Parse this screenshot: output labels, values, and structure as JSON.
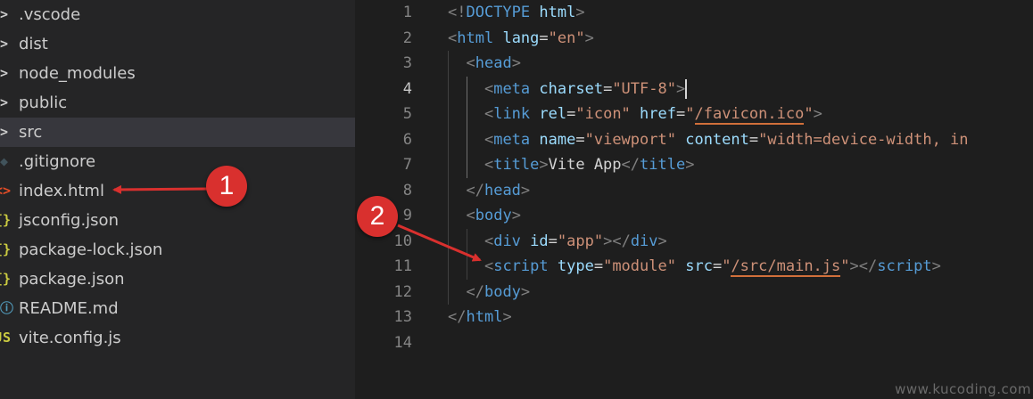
{
  "explorer": {
    "items": [
      {
        "label": ".vscode",
        "icon": "chevron-right-icon",
        "glyph": ">",
        "color": "#cccccc"
      },
      {
        "label": "dist",
        "icon": "chevron-right-icon",
        "glyph": ">",
        "color": "#cccccc"
      },
      {
        "label": "node_modules",
        "icon": "chevron-right-icon",
        "glyph": ">",
        "color": "#cccccc"
      },
      {
        "label": "public",
        "icon": "chevron-right-icon",
        "glyph": ">",
        "color": "#cccccc"
      },
      {
        "label": "src",
        "icon": "chevron-right-icon",
        "glyph": ">",
        "color": "#cccccc",
        "selected": true
      },
      {
        "label": ".gitignore",
        "icon": "git-file-icon",
        "glyph": "◆",
        "color": "#41535b"
      },
      {
        "label": "index.html",
        "icon": "html-file-icon",
        "glyph": "<>",
        "color": "#e44d26"
      },
      {
        "label": "jsconfig.json",
        "icon": "json-file-icon",
        "glyph": "{}",
        "color": "#cbcb41"
      },
      {
        "label": "package-lock.json",
        "icon": "json-file-icon",
        "glyph": "{}",
        "color": "#cbcb41"
      },
      {
        "label": "package.json",
        "icon": "json-file-icon",
        "glyph": "{}",
        "color": "#cbcb41"
      },
      {
        "label": "README.md",
        "icon": "info-file-icon",
        "glyph": "ⓘ",
        "color": "#519aba"
      },
      {
        "label": "vite.config.js",
        "icon": "js-file-icon",
        "glyph": "JS",
        "color": "#cbcb41"
      }
    ]
  },
  "editor": {
    "current_line": 4,
    "lines": [
      {
        "n": "1",
        "tokens": [
          [
            "br",
            "<!"
          ],
          [
            "tag",
            "DOCTYPE"
          ],
          [
            "txt",
            " "
          ],
          [
            "attr",
            "html"
          ],
          [
            "br",
            ">"
          ]
        ]
      },
      {
        "n": "2",
        "tokens": [
          [
            "br",
            "<"
          ],
          [
            "tag",
            "html"
          ],
          [
            "txt",
            " "
          ],
          [
            "attr",
            "lang"
          ],
          [
            "txt",
            "="
          ],
          [
            "str",
            "\"en\""
          ],
          [
            "br",
            ">"
          ]
        ]
      },
      {
        "n": "3",
        "tokens": [
          [
            "txt",
            "  "
          ],
          [
            "br",
            "<"
          ],
          [
            "tag",
            "head"
          ],
          [
            "br",
            ">"
          ]
        ]
      },
      {
        "n": "4",
        "tokens": [
          [
            "txt",
            "    "
          ],
          [
            "br",
            "<"
          ],
          [
            "tag",
            "meta"
          ],
          [
            "txt",
            " "
          ],
          [
            "attr",
            "charset"
          ],
          [
            "txt",
            "="
          ],
          [
            "str",
            "\"UTF-8\""
          ],
          [
            "br",
            ">"
          ],
          [
            "cursor",
            ""
          ]
        ]
      },
      {
        "n": "5",
        "tokens": [
          [
            "txt",
            "    "
          ],
          [
            "br",
            "<"
          ],
          [
            "tag",
            "link"
          ],
          [
            "txt",
            " "
          ],
          [
            "attr",
            "rel"
          ],
          [
            "txt",
            "="
          ],
          [
            "str",
            "\"icon\""
          ],
          [
            "txt",
            " "
          ],
          [
            "attr",
            "href"
          ],
          [
            "txt",
            "="
          ],
          [
            "str",
            "\""
          ],
          [
            "link",
            "/favicon.ico"
          ],
          [
            "str",
            "\""
          ],
          [
            "br",
            ">"
          ]
        ]
      },
      {
        "n": "6",
        "tokens": [
          [
            "txt",
            "    "
          ],
          [
            "br",
            "<"
          ],
          [
            "tag",
            "meta"
          ],
          [
            "txt",
            " "
          ],
          [
            "attr",
            "name"
          ],
          [
            "txt",
            "="
          ],
          [
            "str",
            "\"viewport\""
          ],
          [
            "txt",
            " "
          ],
          [
            "attr",
            "content"
          ],
          [
            "txt",
            "="
          ],
          [
            "str",
            "\"width=device-width, in"
          ]
        ]
      },
      {
        "n": "7",
        "tokens": [
          [
            "txt",
            "    "
          ],
          [
            "br",
            "<"
          ],
          [
            "tag",
            "title"
          ],
          [
            "br",
            ">"
          ],
          [
            "txt",
            "Vite App"
          ],
          [
            "br",
            "</"
          ],
          [
            "tag",
            "title"
          ],
          [
            "br",
            ">"
          ]
        ]
      },
      {
        "n": "8",
        "tokens": [
          [
            "txt",
            "  "
          ],
          [
            "br",
            "</"
          ],
          [
            "tag",
            "head"
          ],
          [
            "br",
            ">"
          ]
        ]
      },
      {
        "n": "9",
        "tokens": [
          [
            "txt",
            "  "
          ],
          [
            "br",
            "<"
          ],
          [
            "tag",
            "body"
          ],
          [
            "br",
            ">"
          ]
        ]
      },
      {
        "n": "10",
        "tokens": [
          [
            "txt",
            "    "
          ],
          [
            "br",
            "<"
          ],
          [
            "tag",
            "div"
          ],
          [
            "txt",
            " "
          ],
          [
            "attr",
            "id"
          ],
          [
            "txt",
            "="
          ],
          [
            "str",
            "\"app\""
          ],
          [
            "br",
            "></"
          ],
          [
            "tag",
            "div"
          ],
          [
            "br",
            ">"
          ]
        ]
      },
      {
        "n": "11",
        "tokens": [
          [
            "txt",
            "    "
          ],
          [
            "br",
            "<"
          ],
          [
            "tag",
            "script"
          ],
          [
            "txt",
            " "
          ],
          [
            "attr",
            "type"
          ],
          [
            "txt",
            "="
          ],
          [
            "str",
            "\"module\""
          ],
          [
            "txt",
            " "
          ],
          [
            "attr",
            "src"
          ],
          [
            "txt",
            "="
          ],
          [
            "str",
            "\""
          ],
          [
            "link",
            "/src/main.js"
          ],
          [
            "str",
            "\""
          ],
          [
            "br",
            "></"
          ],
          [
            "tag",
            "script"
          ],
          [
            "br",
            ">"
          ]
        ]
      },
      {
        "n": "12",
        "tokens": [
          [
            "txt",
            "  "
          ],
          [
            "br",
            "</"
          ],
          [
            "tag",
            "body"
          ],
          [
            "br",
            ">"
          ]
        ]
      },
      {
        "n": "13",
        "tokens": [
          [
            "br",
            "</"
          ],
          [
            "tag",
            "html"
          ],
          [
            "br",
            ">"
          ]
        ]
      },
      {
        "n": "14",
        "tokens": []
      }
    ]
  },
  "annotations": {
    "badge_1": "1",
    "badge_2": "2",
    "color": "#d9302e"
  },
  "watermark": "www.kucoding.com"
}
